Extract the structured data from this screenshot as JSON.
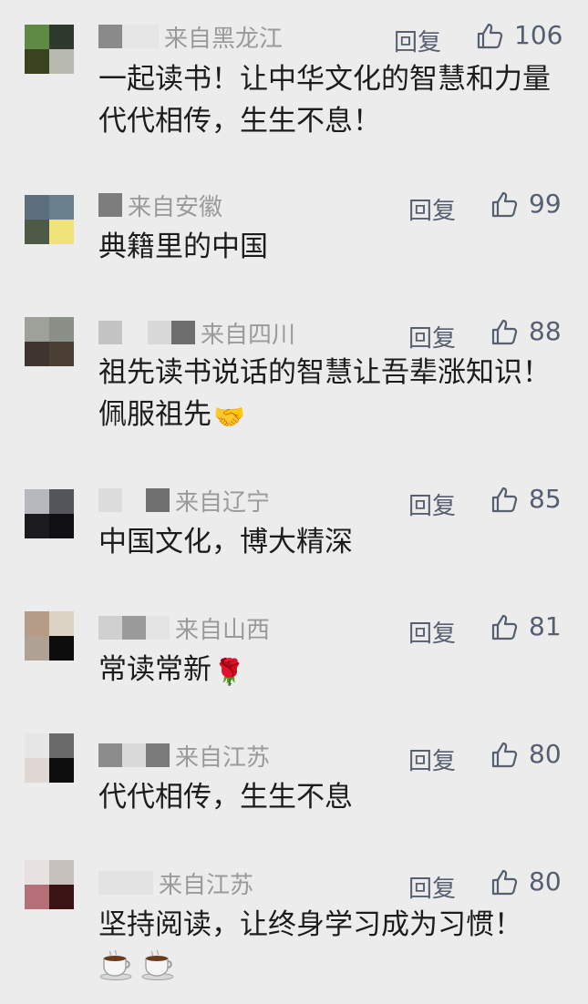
{
  "comments": [
    {
      "location": "来自黑龙江",
      "reply_label": "回复",
      "likes": "106",
      "text": "一起读书！让中华文化的智慧和力量代代相传，生生不息！",
      "avatar_colors": [
        "#5f8a46",
        "#2f3a2c",
        "#39441f",
        "#b9bab0"
      ],
      "name_blocks": [
        "#8a8a8a",
        "#c9c9c9"
      ]
    },
    {
      "location": "来自安徽",
      "reply_label": "回复",
      "likes": "99",
      "text": "典籍里的中国",
      "avatar_colors": [
        "#5b6f7d",
        "#6a7f8c",
        "#4d5a45",
        "#efe37a"
      ],
      "name_blocks": [
        "#7d7d7d"
      ]
    },
    {
      "location": "来自四川",
      "reply_label": "回复",
      "likes": "88",
      "text": "祖先读书说话的智慧让吾辈涨知识！佩服祖先",
      "emoji": "🤝",
      "avatar_colors": [
        "#9ea19a",
        "#8a8f87",
        "#3f3430",
        "#4a3e35"
      ],
      "name_blocks": [
        "#c4c4c4",
        "#d8d8d8",
        "#6e6e6e"
      ]
    },
    {
      "location": "来自辽宁",
      "reply_label": "回复",
      "likes": "85",
      "text": "中国文化，博大精深",
      "avatar_colors": [
        "#b7b8bd",
        "#55565b",
        "#1b1b1f",
        "#101014"
      ],
      "name_blocks": [
        "#dcdcdc",
        "#6f6f6f"
      ]
    },
    {
      "location": "来自山西",
      "reply_label": "回复",
      "likes": "81",
      "text": "常读常新",
      "emoji": "🌹",
      "avatar_colors": [
        "#b69c86",
        "#ddd3c4",
        "#b0a195",
        "#0d0d0d"
      ],
      "name_blocks": [
        "#d0d0d0",
        "#9a9a9a",
        "#e4e4e4"
      ]
    },
    {
      "location": "来自江苏",
      "reply_label": "回复",
      "likes": "80",
      "text": "代代相传，生生不息",
      "avatar_colors": [
        "#e6e6e6",
        "#6a6a6a",
        "#e0d8d4",
        "#0e0e0e"
      ],
      "name_blocks": [
        "#8c8c8c",
        "#dadada",
        "#7a7a7a"
      ]
    },
    {
      "location": "来自江苏",
      "reply_label": "回复",
      "likes": "80",
      "text": "坚持阅读，让终身学习成为习惯！",
      "cups": [
        "☕",
        "☕"
      ],
      "avatar_colors": [
        "#e7e2e0",
        "#c7c1be",
        "#b57077",
        "#3a1414"
      ],
      "name_blocks": [
        "#e3e3e3"
      ]
    }
  ]
}
